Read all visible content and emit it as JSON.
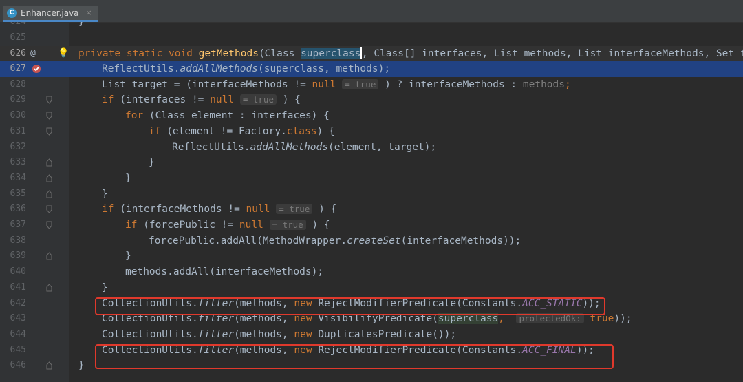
{
  "tab": {
    "icon_letter": "C",
    "label": "Enhancer.java",
    "close": "×"
  },
  "lines": [
    {
      "n": "624",
      "code": "  }"
    },
    {
      "n": "625",
      "code": ""
    },
    {
      "n": "626",
      "code": "private static void getMethods(Class superclass, Class[] interfaces, List methods, List interfaceMethods, Set forc"
    },
    {
      "n": "627",
      "code": "    ReflectUtils.addAllMethods(superclass, methods);"
    },
    {
      "n": "628",
      "code": "    List target = (interfaceMethods != null = true ) ? interfaceMethods : methods;"
    },
    {
      "n": "629",
      "code": "    if (interfaces != null = true ) {"
    },
    {
      "n": "630",
      "code": "        for (Class element : interfaces) {"
    },
    {
      "n": "631",
      "code": "            if (element != Factory.class) {"
    },
    {
      "n": "632",
      "code": "                ReflectUtils.addAllMethods(element, target);"
    },
    {
      "n": "633",
      "code": "            }"
    },
    {
      "n": "634",
      "code": "        }"
    },
    {
      "n": "635",
      "code": "    }"
    },
    {
      "n": "636",
      "code": "    if (interfaceMethods != null = true ) {"
    },
    {
      "n": "637",
      "code": "        if (forcePublic != null = true ) {"
    },
    {
      "n": "638",
      "code": "            forcePublic.addAll(MethodWrapper.createSet(interfaceMethods));"
    },
    {
      "n": "639",
      "code": "        }"
    },
    {
      "n": "640",
      "code": "        methods.addAll(interfaceMethods);"
    },
    {
      "n": "641",
      "code": "    }"
    },
    {
      "n": "642",
      "code": "    CollectionUtils.filter(methods, new RejectModifierPredicate(Constants.ACC_STATIC));"
    },
    {
      "n": "643",
      "code": "    CollectionUtils.filter(methods, new VisibilityPredicate(superclass, protectedOk: true));"
    },
    {
      "n": "644",
      "code": "    CollectionUtils.filter(methods, new DuplicatesPredicate());"
    },
    {
      "n": "645",
      "code": "    CollectionUtils.filter(methods, new RejectModifierPredicate(Constants.ACC_FINAL));"
    },
    {
      "n": "646",
      "code": "}"
    }
  ],
  "tokens": {
    "private": "private",
    "static": "static",
    "void": "void",
    "getMethods": "getMethods",
    "Class": "Class",
    "superclass": "superclass",
    "rest626": ", Class[] interfaces, List methods, List interfaceMethods, Set forc",
    "ReflectUtils": "ReflectUtils.",
    "addAllMethods": "addAllMethods",
    "args627": "(superclass, methods);",
    "list_target": "List target = (interfaceMethods != ",
    "null": "null",
    "eq_true": "= true",
    "ternary": " ) ? interfaceMethods : ",
    "methods_gray": "methods",
    "semi": ";",
    "if": "if",
    "for": "for",
    "new": "new",
    "class": "class",
    "if_interfaces": " (interfaces != ",
    "brace_open": " ) {",
    "for_body": " (Class element : interfaces) {",
    "if_element": " (element != Factory.",
    "brace2": ") {",
    "args632": "(element, target);",
    "close": "}",
    "if_interfaceMethods": " (interfaceMethods != ",
    "if_forcePublic": " (forcePublic != ",
    "force_add": "forcePublic.addAll(MethodWrapper.",
    "createSet": "createSet",
    "args638": "(interfaceMethods));",
    "methods_addAll": "methods.addAll(interfaceMethods);",
    "CollectionUtils": "CollectionUtils.",
    "filter": "filter",
    "methods_comma": "(methods, ",
    "reject": " RejectModifierPredicate(Constants.",
    "ACC_STATIC": "ACC_STATIC",
    "ACC_FINAL": "ACC_FINAL",
    "end_paren": "));",
    "visibility": " VisibilityPredicate(",
    "superclass2": "superclass",
    "comma": ", ",
    "protectedOk": "protectedOk:",
    "true_val": " true",
    "end643": "));",
    "duplicates": " DuplicatesPredicate());",
    "at": "@",
    "bulb": "💡"
  },
  "colors": {
    "keyword": "#cc7832",
    "method": "#ffc66d",
    "constant": "#9876aa",
    "highlight_box": "#e0392c",
    "selection_line": "#214283"
  }
}
